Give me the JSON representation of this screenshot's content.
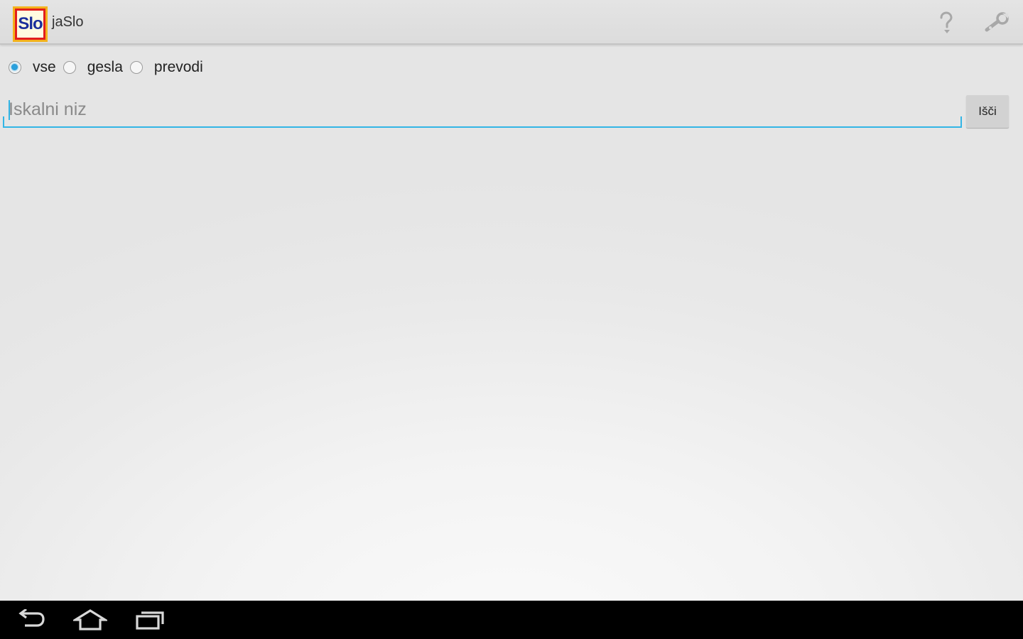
{
  "app": {
    "title": "jaSlo",
    "icon_text": "Slo",
    "icon_colors": {
      "frame": "#e21e1e",
      "border": "#f3b21c",
      "text": "#1b2f9c"
    }
  },
  "action_bar": {
    "icons": [
      "help-icon",
      "settings-icon"
    ]
  },
  "filter": {
    "options": [
      {
        "label": "vse",
        "selected": true
      },
      {
        "label": "gesla",
        "selected": false
      },
      {
        "label": "prevodi",
        "selected": false
      }
    ]
  },
  "search": {
    "placeholder": "Iskalni niz",
    "value": "",
    "button_label": "Išči"
  },
  "nav_bar": {
    "icons": [
      "back-icon",
      "home-icon",
      "recent-apps-icon"
    ]
  },
  "colors": {
    "accent": "#33b5e5",
    "radio_selected": "#2aa0dc",
    "nav_bar": "#000000"
  }
}
